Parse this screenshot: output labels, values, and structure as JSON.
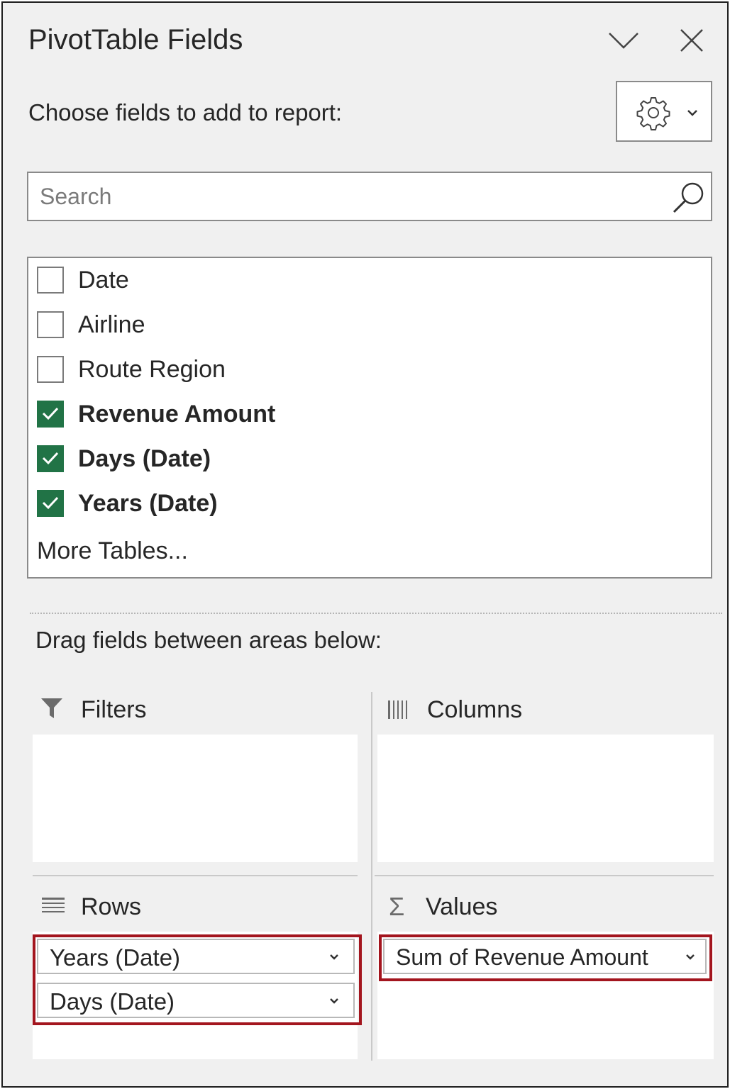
{
  "header": {
    "title": "PivotTable Fields",
    "subtitle": "Choose fields to add to report:",
    "chevron_icon": "chevron-down-icon",
    "close_icon": "close-icon",
    "tools_icon": "gear-icon"
  },
  "search": {
    "placeholder": "Search",
    "value": "",
    "icon": "search-icon"
  },
  "fields": [
    {
      "label": "Date",
      "checked": false
    },
    {
      "label": "Airline",
      "checked": false
    },
    {
      "label": "Route Region",
      "checked": false
    },
    {
      "label": "Revenue Amount",
      "checked": true
    },
    {
      "label": "Days (Date)",
      "checked": true
    },
    {
      "label": "Years (Date)",
      "checked": true
    }
  ],
  "more_tables": "More Tables...",
  "drag_hint": "Drag fields between areas below:",
  "areas": {
    "filters": {
      "label": "Filters",
      "icon": "filter-icon",
      "items": []
    },
    "columns": {
      "label": "Columns",
      "icon": "columns-icon",
      "items": []
    },
    "rows": {
      "label": "Rows",
      "icon": "rows-icon",
      "items": [
        "Years (Date)",
        "Days (Date)"
      ]
    },
    "values": {
      "label": "Values",
      "icon": "sigma-icon",
      "items": [
        "Sum of Revenue Amount"
      ]
    }
  },
  "colors": {
    "checkbox_checked": "#217346",
    "highlight_border": "#a3151e",
    "pane_background": "#f0f0f0"
  }
}
